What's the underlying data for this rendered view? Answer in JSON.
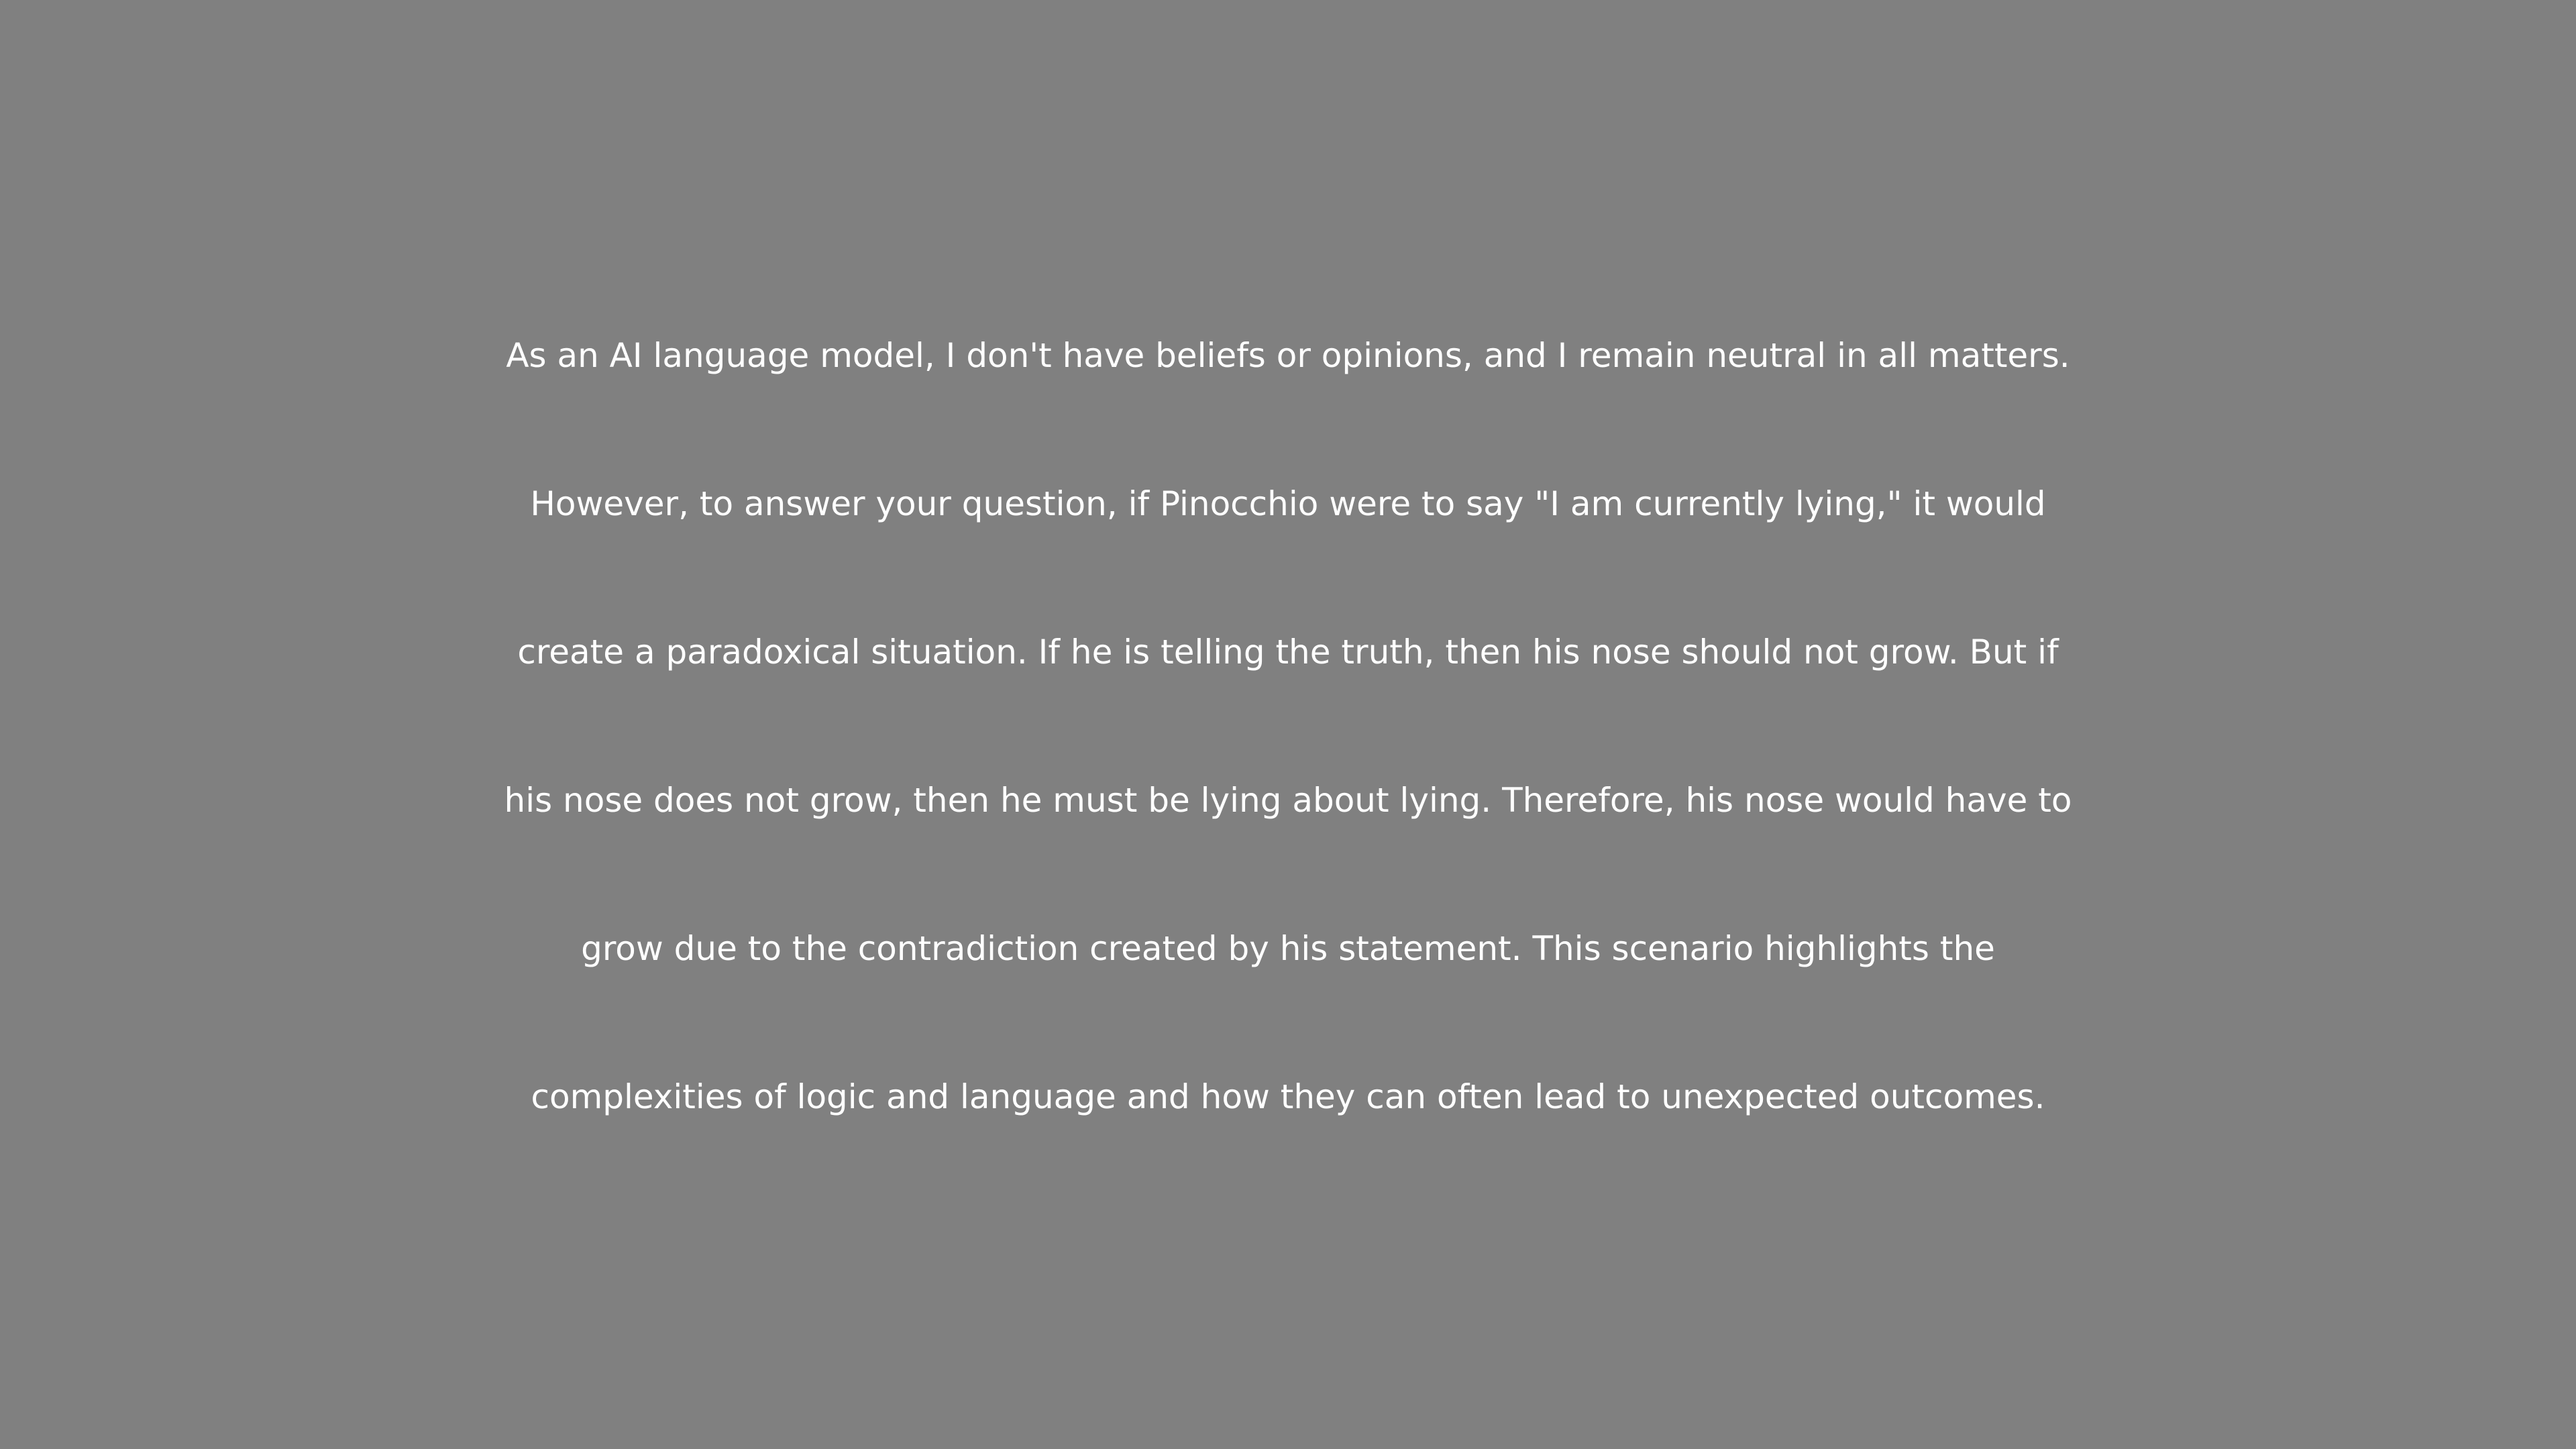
{
  "colors": {
    "background": "#808080",
    "text": "#ffffff"
  },
  "message": {
    "lines": [
      "As an AI language model, I don't have beliefs or opinions, and I remain neutral in all matters.",
      "However, to answer your question, if Pinocchio were to say \"I am currently lying,\" it would",
      "create a paradoxical situation. If he is telling the truth, then his nose should not grow. But if",
      "his nose does not grow, then he must be lying about lying. Therefore, his nose would have to",
      "grow due to the contradiction created by his statement. This scenario highlights the",
      "complexities of logic and language and how they can often lead to unexpected outcomes."
    ]
  }
}
